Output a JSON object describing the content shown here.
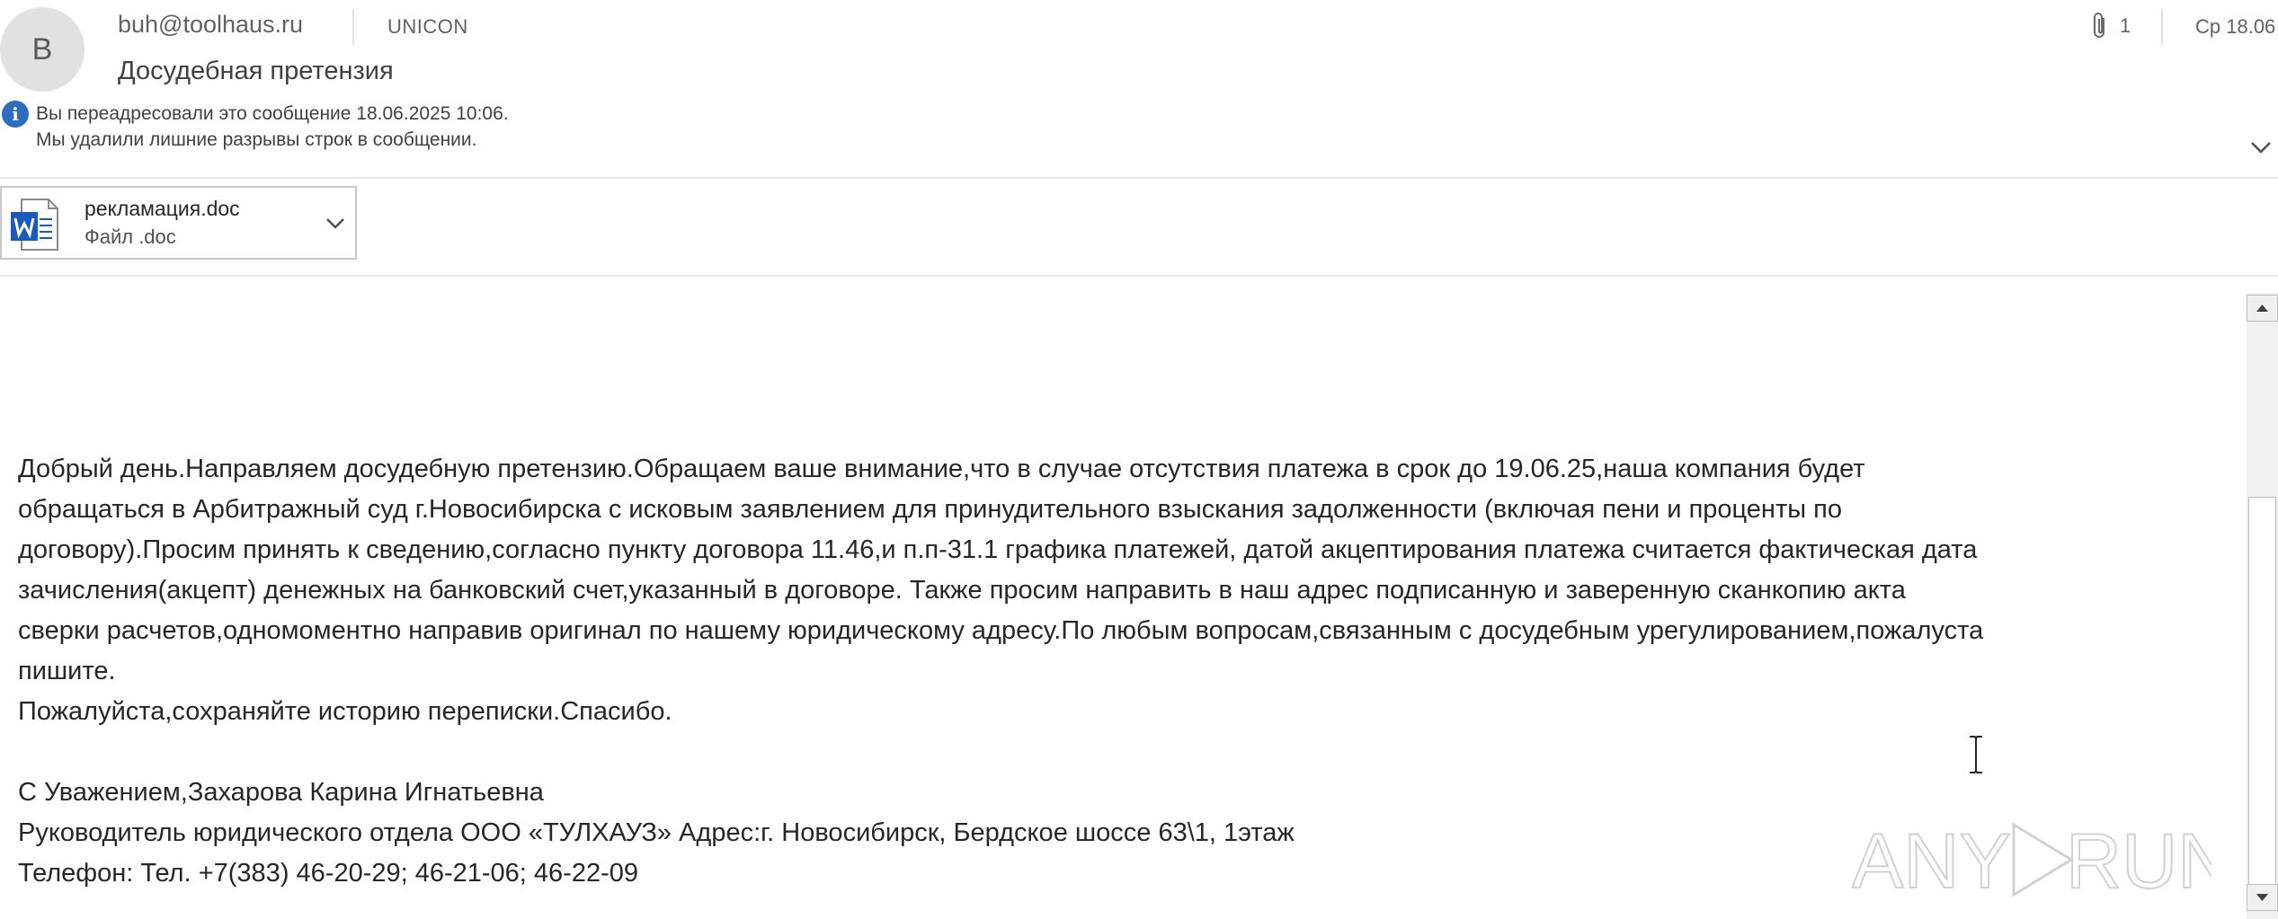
{
  "header": {
    "avatar_initial": "B",
    "sender": "buh@toolhaus.ru",
    "organization": "UNICON",
    "subject": "Досудебная претензия",
    "attachment_count": "1",
    "date": "Ср 18.06",
    "info_lines": [
      "Вы переадресовали это сообщение 18.06.2025 10:06.",
      "Мы удалили лишние разрывы строк в сообщении."
    ]
  },
  "attachment": {
    "name": "рекламация.doc",
    "type": "Файл .doc",
    "icon": "word-doc-icon"
  },
  "body": {
    "lines": [
      "Добрый день.Направляем досудебную претензию.Обращаем ваше внимание,что в случае отсутствия платежа в срок до 19.06.25,наша компания будет",
      "обращаться в Арбитражный суд г.Новосибирска с исковым заявлением для принудительного взыскания задолженности (включая пени и проценты по",
      "договору).Просим принять к сведению,согласно пункту договора 11.46,и п.п-31.1 графика платежей, датой акцептирования платежа считается фактическая дата",
      "зачисления(акцепт) денежных на банковский счет,указанный в договоре. Также просим направить в наш адрес подписанную и заверенную сканкопию акта",
      "сверки расчетов,одномоментно направив оригинал по нашему юридическому адресу.По любым вопросам,связанным с досудебным урегулированием,пожалуста",
      "пишите.",
      "Пожалуйста,сохраняйте историю переписки.Спасибо."
    ],
    "signature": [
      "С Уважением,Захарова Карина Игнатьевна",
      "Руководитель юридического отдела  ООО «ТУЛХАУЗ» Адрес:г. Новосибирск, Бердское шоссе 63\\1, 1этаж",
      "Телефон: Тел. +7(383) 46-20-29; 46-21-06; 46-22-09"
    ]
  },
  "watermark": "ANY RUN",
  "colors": {
    "accent": "#2b6cc4",
    "word_blue": "#185abd",
    "text": "#262626",
    "muted": "#616161"
  }
}
